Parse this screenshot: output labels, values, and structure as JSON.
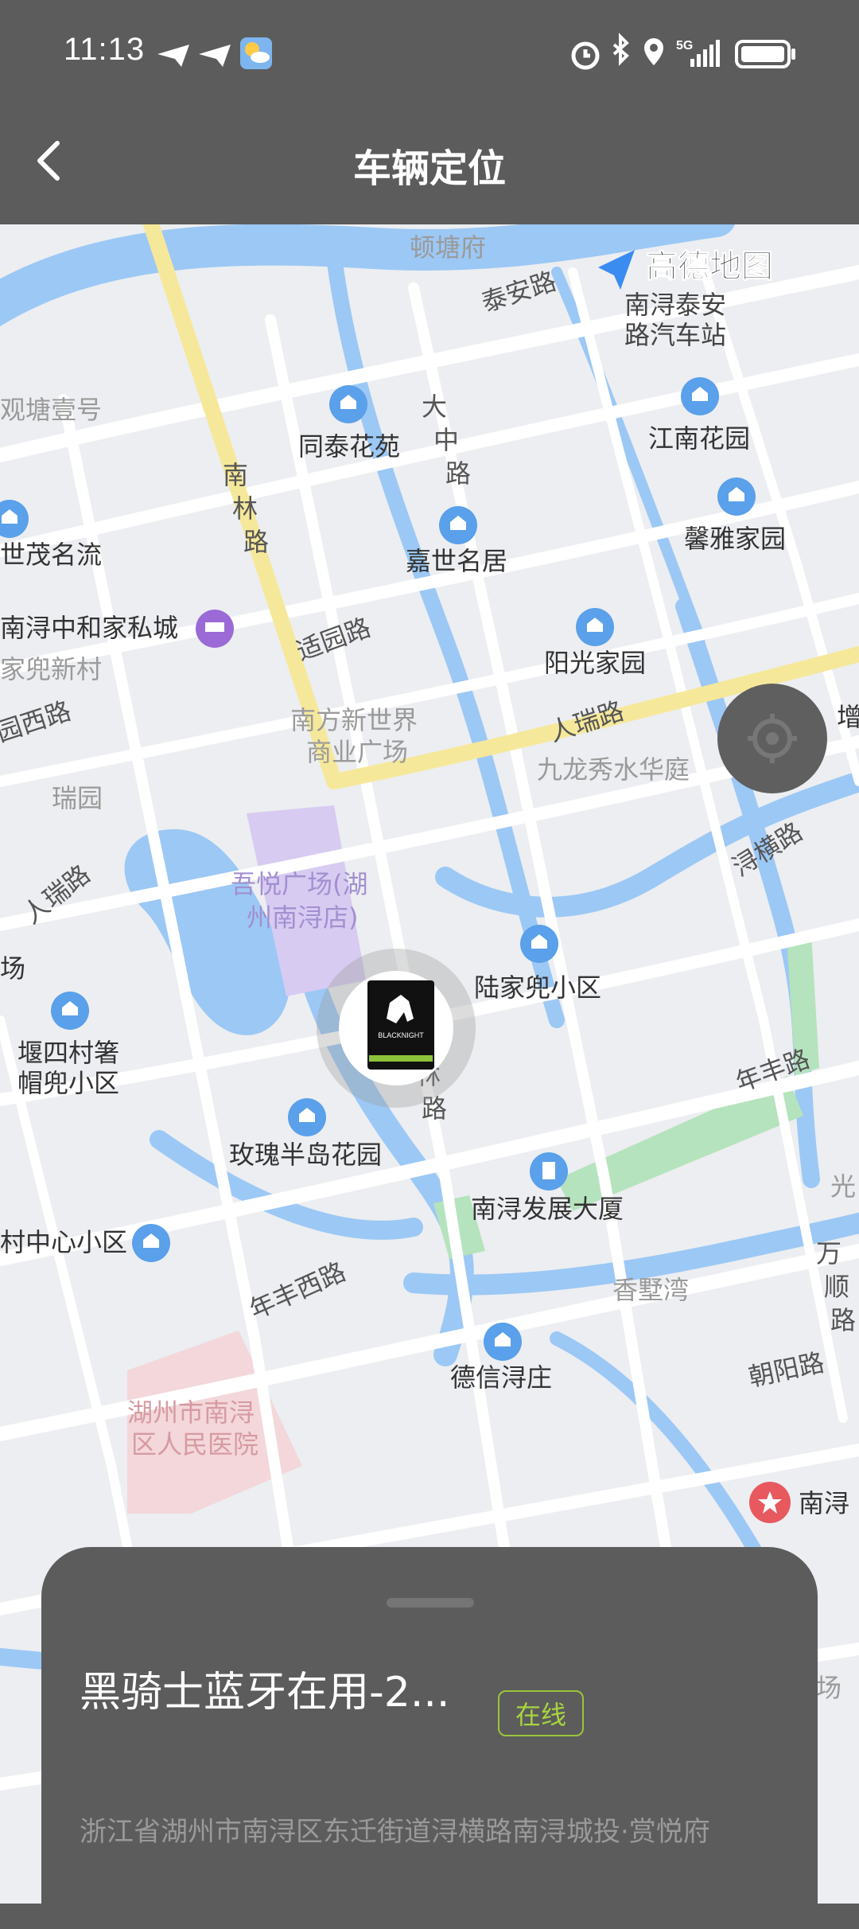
{
  "status_bar": {
    "time": "11:13"
  },
  "header": {
    "title": "车辆定位"
  },
  "map": {
    "provider": "高德地图",
    "labels": [
      {
        "text": "顿塘府",
        "kind": "gray"
      },
      {
        "text": "泰安路",
        "kind": "road"
      },
      {
        "text": "南浔泰安",
        "kind": "poi"
      },
      {
        "text": "路汽车站",
        "kind": "poi"
      },
      {
        "text": "观塘壹号",
        "kind": "gray"
      },
      {
        "text": "同泰花苑",
        "kind": "poi"
      },
      {
        "text": "江南花园",
        "kind": "poi"
      },
      {
        "text": "大",
        "kind": "road"
      },
      {
        "text": "中",
        "kind": "road"
      },
      {
        "text": "路",
        "kind": "road"
      },
      {
        "text": "南",
        "kind": "road"
      },
      {
        "text": "林",
        "kind": "road"
      },
      {
        "text": "路",
        "kind": "road"
      },
      {
        "text": "世茂名流",
        "kind": "poi"
      },
      {
        "text": "嘉世名居",
        "kind": "poi"
      },
      {
        "text": "馨雅家园",
        "kind": "poi"
      },
      {
        "text": "南浔中和家私城",
        "kind": "poi"
      },
      {
        "text": "家兜新村",
        "kind": "gray"
      },
      {
        "text": "适园路",
        "kind": "road"
      },
      {
        "text": "阳光家园",
        "kind": "poi"
      },
      {
        "text": "园西路",
        "kind": "road"
      },
      {
        "text": "南方新世界",
        "kind": "gray"
      },
      {
        "text": "商业广场",
        "kind": "gray"
      },
      {
        "text": "人瑞路",
        "kind": "road"
      },
      {
        "text": "九龙秀水华庭",
        "kind": "gray"
      },
      {
        "text": "增",
        "kind": "poi"
      },
      {
        "text": "瑞园",
        "kind": "gray"
      },
      {
        "text": "人瑞路",
        "kind": "road"
      },
      {
        "text": "浔横路",
        "kind": "road"
      },
      {
        "text": "吾悦广场(湖",
        "kind": "purple"
      },
      {
        "text": "州南浔店)",
        "kind": "purple"
      },
      {
        "text": "场",
        "kind": "poi"
      },
      {
        "text": "陆家兜小区",
        "kind": "poi"
      },
      {
        "text": "堰四村箸",
        "kind": "poi"
      },
      {
        "text": "帽兜小区",
        "kind": "poi"
      },
      {
        "text": "林",
        "kind": "road"
      },
      {
        "text": "路",
        "kind": "road"
      },
      {
        "text": "年丰路",
        "kind": "road"
      },
      {
        "text": "玫瑰半岛花园",
        "kind": "poi"
      },
      {
        "text": "南浔发展大厦",
        "kind": "poi"
      },
      {
        "text": "光",
        "kind": "gray"
      },
      {
        "text": "村中心小区",
        "kind": "poi"
      },
      {
        "text": "年丰西路",
        "kind": "road"
      },
      {
        "text": "万",
        "kind": "road"
      },
      {
        "text": "顺",
        "kind": "road"
      },
      {
        "text": "路",
        "kind": "road"
      },
      {
        "text": "香墅湾",
        "kind": "gray"
      },
      {
        "text": "朝阳路",
        "kind": "road"
      },
      {
        "text": "德信浔庄",
        "kind": "poi"
      },
      {
        "text": "湖州市南浔",
        "kind": "pink"
      },
      {
        "text": "区人民医院",
        "kind": "pink"
      },
      {
        "text": "南浔",
        "kind": "poi"
      },
      {
        "text": "场",
        "kind": "gray"
      },
      {
        "text": "南浔",
        "kind": "gray"
      }
    ]
  },
  "vehicle": {
    "name": "黑骑士蓝牙在用-2...",
    "status": "在线",
    "address": "浙江省湖州市南浔区东迁街道浔横路南浔城投·赏悦府",
    "avatar_text": "BLACKNIGHT"
  },
  "colors": {
    "chrome": "#5c5c5c",
    "water": "#9cc8f5",
    "road": "#ffffff",
    "main_road": "#f6e89a",
    "green": "#b5e3bd",
    "purple": "#d7cbf2",
    "pink": "#f3d7da",
    "online": "#a8d43f"
  }
}
